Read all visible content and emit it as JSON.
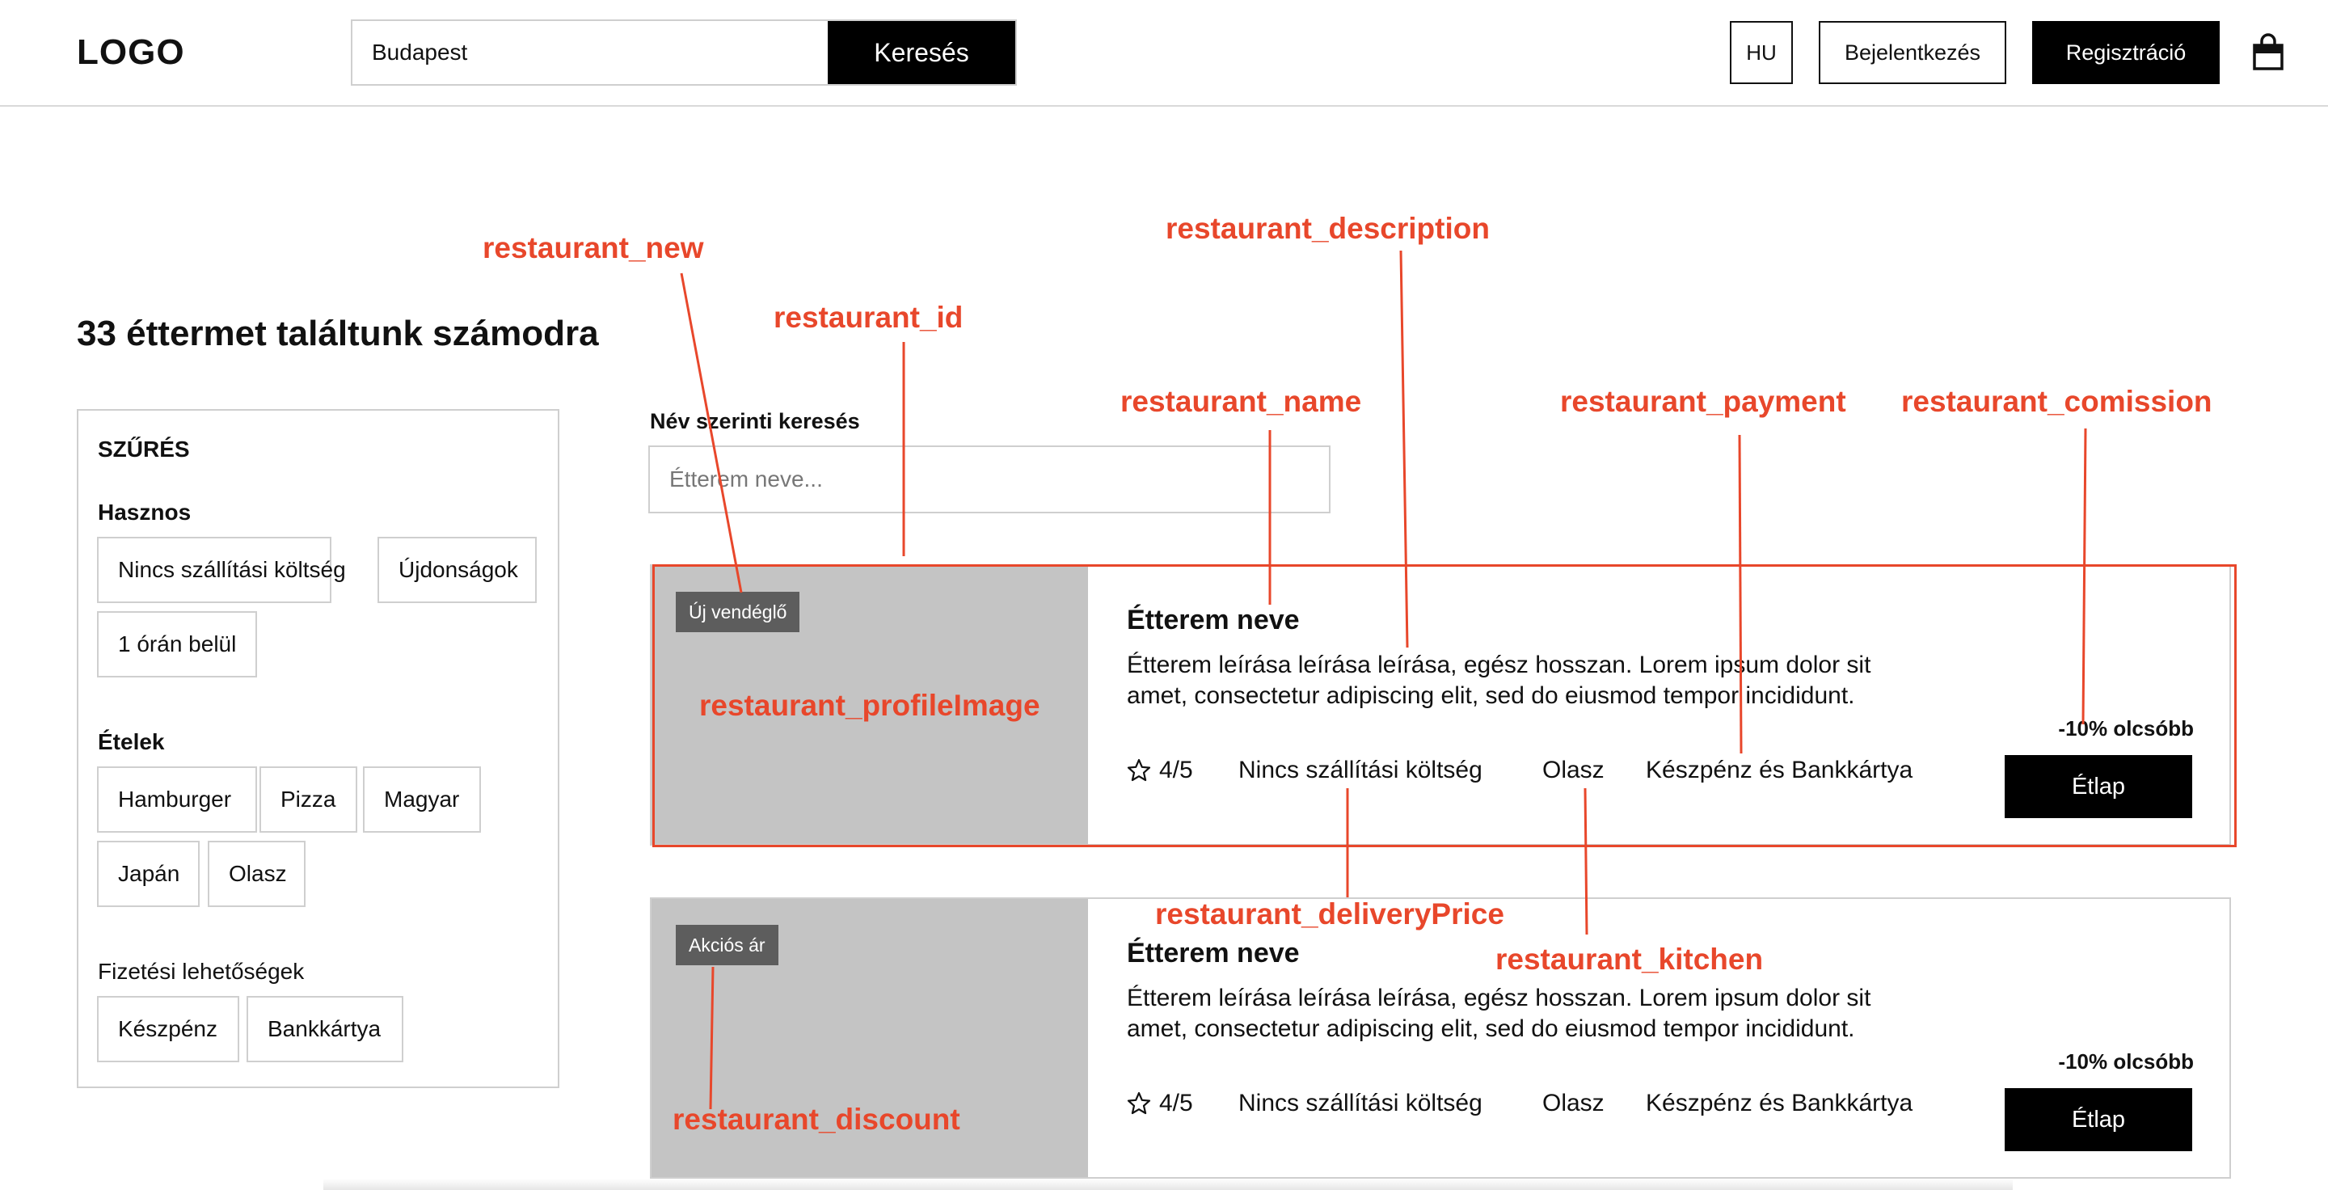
{
  "header": {
    "logo": "LOGO",
    "search_value": "Budapest",
    "search_button": "Keresés",
    "language": "HU",
    "login": "Bejelentkezés",
    "register": "Regisztráció",
    "cart_icon": "shopping-bag-icon"
  },
  "results_title": "33 éttermet találtunk számodra",
  "filters": {
    "heading": "SZŰRÉS",
    "useful": {
      "title": "Hasznos",
      "chips": [
        "Nincs szállítási költség",
        "Újdonságok",
        "1 órán belül"
      ]
    },
    "foods": {
      "title": "Ételek",
      "chips": [
        "Hamburger",
        "Pizza",
        "Magyar",
        "Japán",
        "Olasz"
      ]
    },
    "payment": {
      "title": "Fizetési lehetőségek",
      "chips": [
        "Készpénz",
        "Bankkártya"
      ]
    }
  },
  "name_search": {
    "label": "Név szerinti keresés",
    "placeholder": "Étterem neve..."
  },
  "restaurants": [
    {
      "badge": "Új vendéglő",
      "name": "Étterem neve",
      "description": "Étterem leírása leírása leírása, egész hosszan. Lorem ipsum dolor sit amet, consectetur adipiscing elit, sed do eiusmod tempor incididunt.",
      "discount": "-10% olcsóbb",
      "rating": "4/5",
      "delivery": "Nincs szállítási költség",
      "kitchen": "Olasz",
      "payment": "Készpénz és Bankkártya",
      "menu_button": "Étlap"
    },
    {
      "badge": "Akciós ár",
      "name": "Étterem neve",
      "description": "Étterem leírása leírása leírása, egész hosszan. Lorem ipsum dolor sit amet, consectetur adipiscing elit, sed do eiusmod tempor incididunt.",
      "discount": "-10% olcsóbb",
      "rating": "4/5",
      "delivery": "Nincs szállítási költség",
      "kitchen": "Olasz",
      "payment": "Készpénz és Bankkártya",
      "menu_button": "Étlap"
    }
  ],
  "annotations": {
    "new": "restaurant_new",
    "id": "restaurant_id",
    "description": "restaurant_description",
    "name": "restaurant_name",
    "payment": "restaurant_payment",
    "comission": "restaurant_comission",
    "profile_image": "restaurant_profileImage",
    "delivery_price": "restaurant_deliveryPrice",
    "kitchen": "restaurant_kitchen",
    "discount": "restaurant_discount",
    "color": "#e8472b"
  }
}
